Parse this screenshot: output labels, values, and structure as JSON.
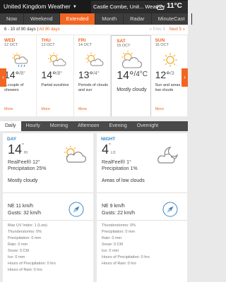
{
  "header": {
    "brand": "United Kingdom Weather",
    "location": "Castle Combe, Unit... Weather",
    "current_temp": "11°C"
  },
  "nav": {
    "tabs": [
      {
        "label": "Now",
        "active": false
      },
      {
        "label": "Weekend",
        "active": false
      },
      {
        "label": "Extended",
        "active": true
      },
      {
        "label": "Month",
        "active": false
      },
      {
        "label": "Radar",
        "active": false
      },
      {
        "label": "MinuteCast",
        "active": false
      }
    ]
  },
  "strip": {
    "range_text": "6 - 10 of 90 days |",
    "all_days": "All 90 days",
    "prev": "« Prev 5",
    "next": "Next 5 »",
    "days": [
      {
        "name": "WED",
        "date": "12 OCT",
        "high": "14°",
        "low": "/8°",
        "desc": "A couple of showers",
        "more": "More",
        "icon": "sun-cloud-rain-icon",
        "selected": false
      },
      {
        "name": "THU",
        "date": "13 OCT",
        "high": "14°",
        "low": "/8°",
        "desc": "Partial sunshine",
        "more": "More",
        "icon": "partly-sunny-icon",
        "selected": false
      },
      {
        "name": "FRI",
        "date": "14 OCT",
        "high": "13°",
        "low": "/4°",
        "desc": "Periods of clouds and sun",
        "more": "More",
        "icon": "partly-sunny-icon",
        "selected": false
      },
      {
        "name": "SAT",
        "date": "15 OCT",
        "high": "14°",
        "low": "/4°C",
        "desc": "Mostly cloudy",
        "more": "",
        "icon": "mostly-cloudy-icon",
        "selected": true
      },
      {
        "name": "SUN",
        "date": "16 OCT",
        "high": "12°",
        "low": "/3",
        "desc": "Sun and areas of low clouds",
        "more": "More",
        "icon": "sun-icon",
        "selected": false
      }
    ]
  },
  "subtabs": [
    {
      "label": "Daily",
      "active": true
    },
    {
      "label": "Hourly",
      "active": false
    },
    {
      "label": "Morning",
      "active": false
    },
    {
      "label": "Afternoon",
      "active": false
    },
    {
      "label": "Evening",
      "active": false
    },
    {
      "label": "Overnight",
      "active": false
    }
  ],
  "day_panel": {
    "heading": "DAY",
    "temp": "14",
    "temp_unit": "°",
    "temp_tag": "HI",
    "realfeel": "RealFeel® 12°",
    "precipitation": "Precipitation 25%",
    "desc": "Mostly cloudy",
    "wind": "NE 11 km/h",
    "gusts": "Gusts: 32 km/h",
    "stats": [
      "Max UV Index: 1 (Low)",
      "Thunderstorms: 0%",
      "Precipitation: 0 mm",
      "Rain: 0 mm",
      "Snow: 0 CM",
      "Ice: 0 mm",
      "Hours of Precipitation: 0 hrs",
      "Hours of Rain: 0 hrs"
    ]
  },
  "night_panel": {
    "heading": "NIGHT",
    "temp": "4",
    "temp_unit": "°",
    "temp_tag": "LO",
    "realfeel": "RealFeel® 1°",
    "precipitation": "Precipitation 1%",
    "desc": "Areas of low clouds",
    "wind": "NE 9 km/h",
    "gusts": "Gusts: 22 km/h",
    "stats": [
      "Thunderstorms: 0%",
      "Precipitation: 0 mm",
      "Rain: 0 mm",
      "Snow: 0 CM",
      "Ice: 0 mm",
      "Hours of Precipitation: 0 hrs",
      "Hours of Rain: 0 hrs"
    ]
  },
  "colors": {
    "accent": "#f26522",
    "panel_heading": "#3a87c5",
    "dark_bar": "#1a1a1a"
  }
}
